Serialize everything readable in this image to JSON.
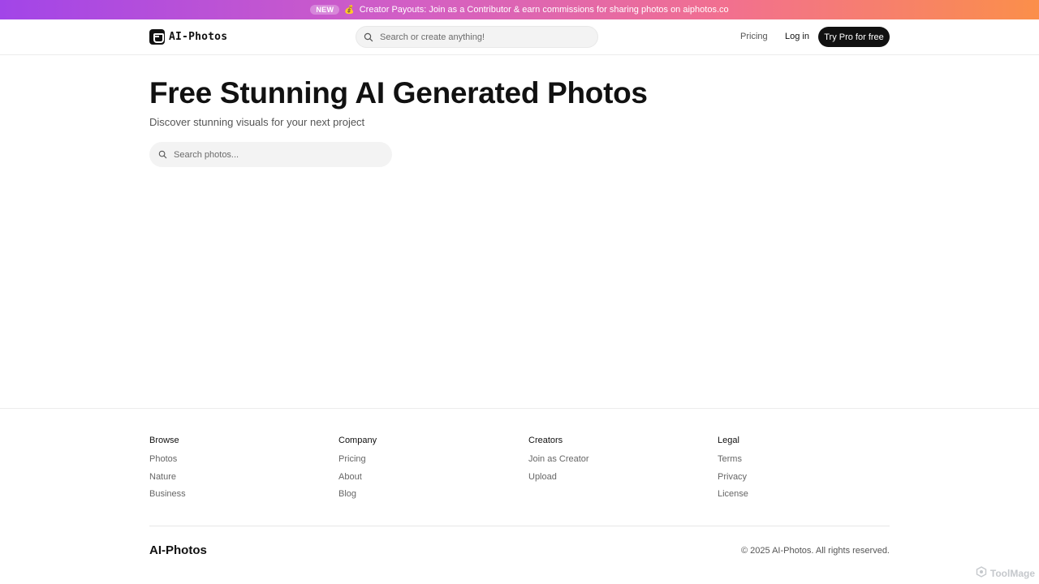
{
  "banner": {
    "badge": "NEW",
    "medal": "💰",
    "text": "Creator Payouts: Join as a Contributor & earn commissions for sharing photos on aiphotos.co"
  },
  "header": {
    "logo_text": "AI-Photos",
    "search_placeholder": "Search or create anything!",
    "pricing_label": "Pricing",
    "login_label": "Log in",
    "cta_label": "Try Pro for free"
  },
  "hero": {
    "title": "Free Stunning AI Generated Photos",
    "subtitle": "Discover stunning visuals for your next project",
    "search_placeholder": "Search photos..."
  },
  "footer": {
    "browse": {
      "title": "Browse",
      "links": [
        "Photos",
        "Nature",
        "Business"
      ]
    },
    "company": {
      "title": "Company",
      "links": [
        "Pricing",
        "About",
        "Blog"
      ]
    },
    "creators": {
      "title": "Creators",
      "links": [
        "Join as Creator",
        "Upload"
      ]
    },
    "legal": {
      "title": "Legal",
      "links": [
        "Terms",
        "Privacy",
        "License"
      ]
    },
    "brand": "AI-Photos",
    "copyright": "© 2025 AI-Photos. All rights reserved."
  },
  "watermark": {
    "text": "ToolMage"
  },
  "colors": {
    "banner_gradient": [
      "#a245e8",
      "#d35fc4",
      "#f2708f",
      "#fb8f4a"
    ],
    "primary": "#111111",
    "muted": "#666666",
    "search_bg": "#f3f3f3"
  },
  "icons": [
    "logo-mark-icon",
    "search-icon",
    "medal-icon",
    "toolmage-icon"
  ]
}
